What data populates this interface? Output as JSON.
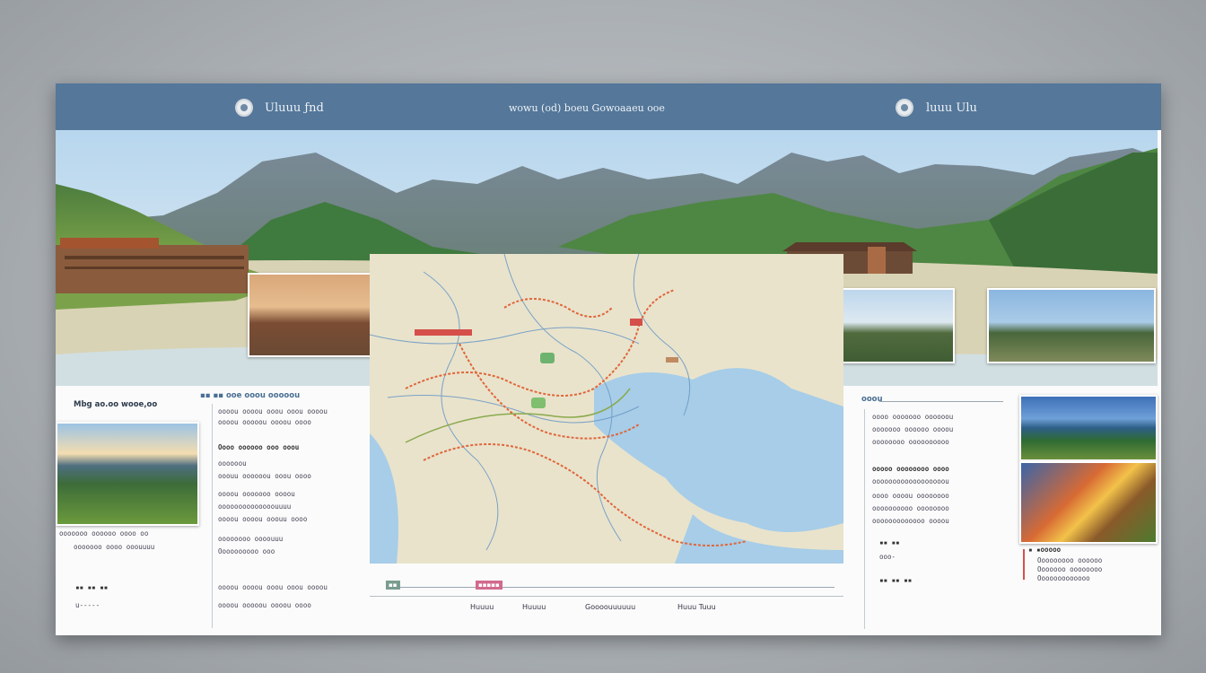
{
  "header": {
    "left_title": "Uluuu ƒnd",
    "center_title": "wowu (od) boeu Gowoaaeu ooe",
    "right_title": "luuu Ulu"
  },
  "left_panel": {
    "heading": "Mbg ao.oo wooe,oo",
    "footer_a": "▪▪ ▪▪ ▪▪",
    "footer_b": "u-----"
  },
  "left_text": {
    "title": "▪▪ ▪▪ ooe ooou ooooou",
    "lines": [
      "oooou oooou ooou ooou oooou",
      "oooou ooooou oooou oooo",
      "ooouu oooooou ooou oooo",
      "oooou ooooooo oooou",
      "oooooooooooooouuuu",
      "oooou oooou ooouu oooo",
      "oooooooo oooouuu"
    ],
    "sub_heading_1": "Oooo oooooo ooo ooou",
    "sub_heading_2": "oooooou",
    "sub_heading_3": "Oooooooooo ooo",
    "left_list": [
      "ooooooo oooooo oooo oo",
      "ooooooo oooo ooouuuu"
    ]
  },
  "right_text": {
    "heading": "ooou",
    "lines": [
      "oooo ooooooo oooooou",
      "ooooooo oooooo oooou",
      "oooooooo oooooooooo",
      "ooooo oooooooo oooo",
      "oooooooooooooooooou",
      "oooo oooou oooooooo",
      "oooooooooo oooooooo",
      "ooooooooooooo oooou"
    ],
    "short_a": "▪▪ ▪▪",
    "short_b": "ooo-",
    "short_c": "▪▪ ▪▪ ▪▪"
  },
  "right_caption": {
    "title": "▪ ▪ooooo",
    "lines": [
      "Ooooooooo oooooo",
      "Ooooooo oooooooo",
      "Ooooooooooooo"
    ]
  },
  "footer": {
    "tabs": [
      "Huuuu",
      "Huuuu",
      "Goooouuuuuu",
      "Huuu Tuuu"
    ],
    "badge_pink": "▪▪▪▪▪",
    "badge_green": "▪▪"
  },
  "colors": {
    "header_bg": "#54779a",
    "sea": "#a7cde8",
    "land": "#e6dfc7",
    "route": "#e0663a",
    "route_secondary": "#6e9bc4"
  }
}
